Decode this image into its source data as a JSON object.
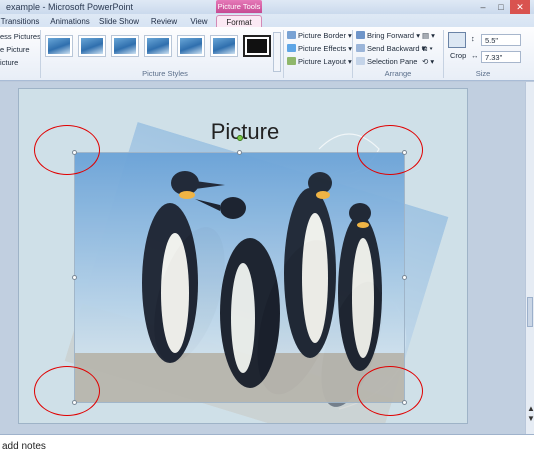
{
  "window": {
    "title": "example - Microsoft PowerPoint",
    "context_tab": "Picture Tools",
    "controls": [
      "–",
      "□",
      "✕"
    ]
  },
  "tabs": [
    {
      "label": "Transitions",
      "active": false
    },
    {
      "label": "Animations",
      "active": false
    },
    {
      "label": "Slide Show",
      "active": false
    },
    {
      "label": "Review",
      "active": false
    },
    {
      "label": "View",
      "active": false
    },
    {
      "label": "Format",
      "active": true
    }
  ],
  "ribbon": {
    "adjust": {
      "items": [
        "ess Pictures",
        "e Picture",
        "icture"
      ]
    },
    "picture_styles": {
      "label": "Picture Styles",
      "thumb_count": 7,
      "selected_index": 6,
      "commands": [
        "Picture Border",
        "Picture Effects",
        "Picture Layout"
      ]
    },
    "arrange": {
      "label": "Arrange",
      "commands": [
        "Bring Forward",
        "Send Backward",
        "Selection Pane"
      ]
    },
    "size": {
      "label": "Size",
      "crop_label": "Crop",
      "height": "5.5\"",
      "width": "7.33\""
    }
  },
  "slide": {
    "title": "Picture"
  },
  "notes": {
    "placeholder": "add notes"
  },
  "colors": {
    "context_tab": "#c64a93",
    "annotation_circle": "#e00000",
    "rotation_handle": "#7ac943"
  }
}
